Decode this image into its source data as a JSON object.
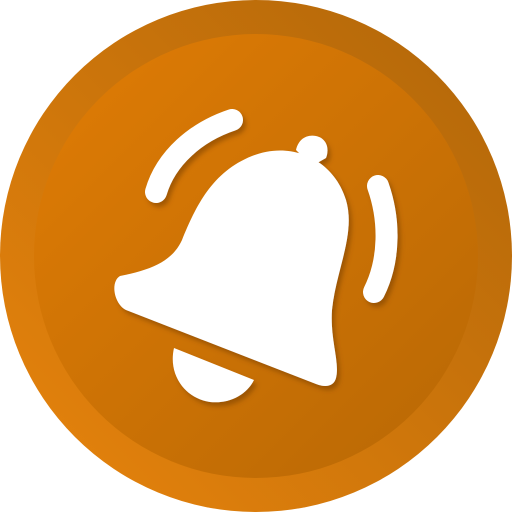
{
  "icon": {
    "name": "ringing-bell-icon",
    "colors": {
      "outer_ring_light": "#E8840C",
      "outer_ring_dark": "#B0660A",
      "inner_disc_light": "#E07C05",
      "inner_disc_dark": "#B86805",
      "glyph": "#FFFFFF",
      "glyph_shadow": "#7A3E00"
    }
  }
}
